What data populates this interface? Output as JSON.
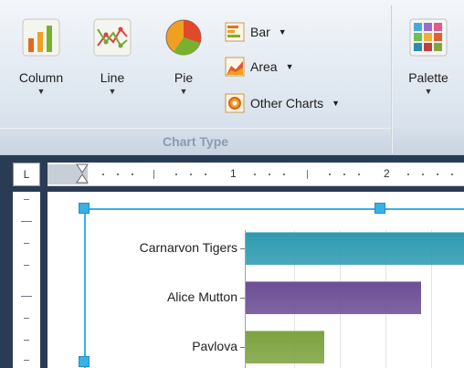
{
  "ribbon": {
    "buttons": {
      "column": "Column",
      "line": "Line",
      "pie": "Pie",
      "palette": "Palette"
    },
    "small_buttons": {
      "bar": "Bar",
      "area": "Area",
      "other": "Other Charts"
    },
    "dropdown_arrow": "▼",
    "group_label": "Chart Type"
  },
  "ruler": {
    "corner": "L",
    "numbers": [
      "1",
      "2"
    ]
  },
  "chart_data": {
    "type": "bar",
    "categories": [
      "Carnarvon Tigers",
      "Alice Mutton",
      "Pavlova"
    ],
    "colors": [
      "#2e9bb2",
      "#6c4e96",
      "#7da33f"
    ],
    "values": [
      100,
      74,
      33
    ]
  }
}
